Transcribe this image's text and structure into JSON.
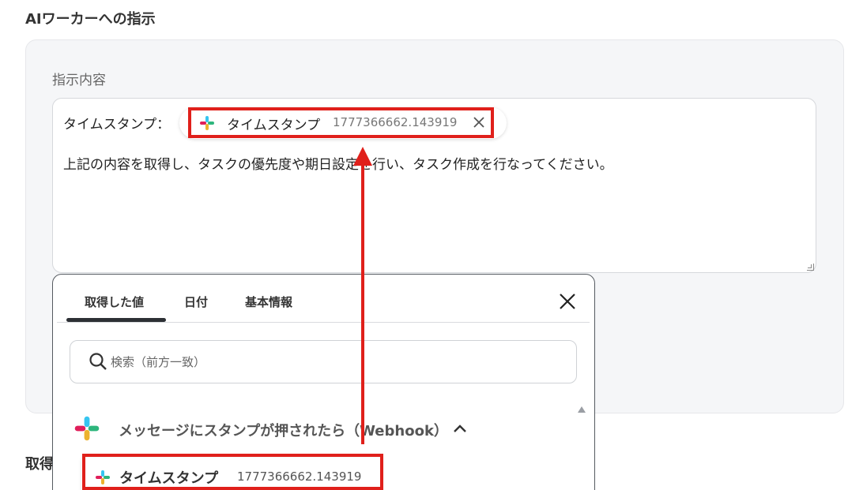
{
  "section_title": "AIワーカーへの指示",
  "instruction_field": {
    "label": "指示内容",
    "prefix": "タイムスタンプ：",
    "chip": {
      "name": "タイムスタンプ",
      "value": "1777366662.143919",
      "icon": "slack-icon"
    },
    "text": "上記の内容を取得し、タスクの優先度や期日設定を行い、タスク作成を行なってください。"
  },
  "background_title": "取得",
  "dropdown": {
    "tabs": [
      {
        "label": "取得した値",
        "active": true
      },
      {
        "label": "日付",
        "active": false
      },
      {
        "label": "基本情報",
        "active": false
      }
    ],
    "search": {
      "placeholder": "検索（前方一致）"
    },
    "group": {
      "title": "メッセージにスタンプが押されたら（Webhook）",
      "icon": "slack-icon",
      "expanded": true
    },
    "items": [
      {
        "name": "タイムスタンプ",
        "value": "1777366662.143919"
      }
    ]
  },
  "colors": {
    "highlight": "#e0201b",
    "panel_bg": "#f5f6f8"
  }
}
